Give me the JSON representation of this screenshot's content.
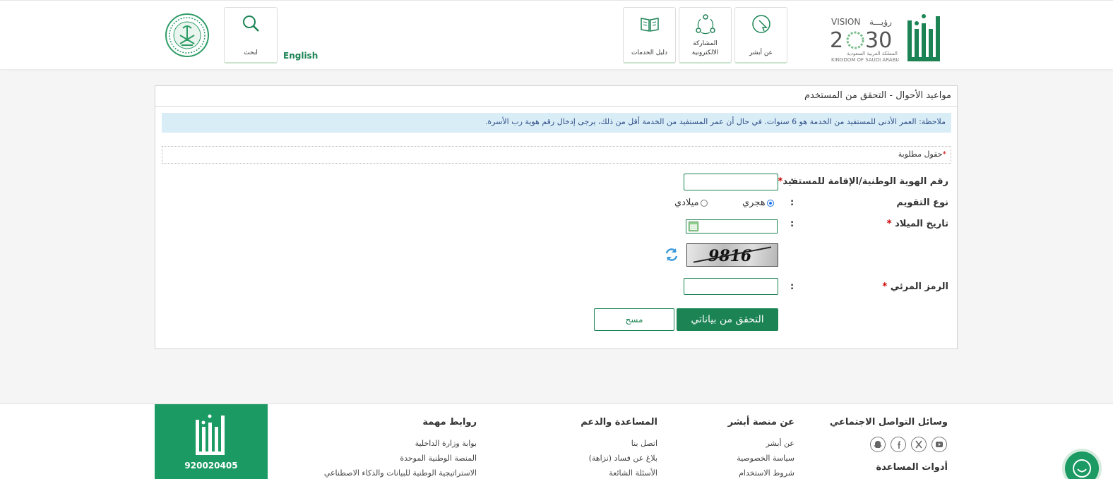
{
  "header": {
    "nav": [
      {
        "label": "عن أبشر"
      },
      {
        "label": "المشاركة الالكترونية"
      },
      {
        "label": "دليل الخدمات"
      }
    ],
    "search_label": "ابحث",
    "english_label": "English"
  },
  "panel": {
    "title": "مواعيد الأحوال - التحقق من المستخدم",
    "note": "ملاحظة: العمر الأدنى للمستفيد من الخدمة هو 6 سنوات. في حال أن عمر المستفيد من الخدمة أقل من ذلك، يرجى إدخال رقم هوية رب الأسرة.",
    "required_note": "حقول مطلوبة",
    "required_star": "*"
  },
  "form": {
    "id_label": "رقم الهوية الوطنية/الإقامة للمستفيد",
    "id_value": "",
    "calendar_label": "نوع التقويم",
    "calendar_options": [
      {
        "label": "هجري",
        "selected": true
      },
      {
        "label": "ميلادي",
        "selected": false
      }
    ],
    "birth_label": "تاريخ الميلاد",
    "captcha_text": "9816",
    "captcha_label": "الرمز المرئي",
    "captcha_value": "",
    "colon": ":",
    "verify_button": "التحقق من بياناتي",
    "clear_button": "مسح"
  },
  "footer": {
    "phone": "920020405",
    "columns": [
      {
        "title": "وسائل التواصل الاجتماعي",
        "links": []
      },
      {
        "title": "عن منصة أبشر",
        "links": [
          "عن أبشر",
          "سياسة الخصوصية",
          "شروط الاستخدام"
        ]
      },
      {
        "title": "المساعدة والدعم",
        "links": [
          "اتصل بنا",
          "بلاغ عن فساد (نزاهة)",
          "الأسئلة الشائعة"
        ]
      },
      {
        "title": "روابط مهمة",
        "links": [
          "بوابة وزارة الداخلية",
          "المنصة الوطنية الموحدة",
          "الاستراتيجية الوطنية للبيانات والذكاء الاصطناعي"
        ]
      }
    ],
    "tools_title": "أدوات المساعدة",
    "social_icons": [
      "youtube-icon",
      "x-icon",
      "facebook-icon",
      "snapchat-icon"
    ]
  },
  "colors": {
    "brand_green": "#1b8354",
    "footer_green": "#1b9a63",
    "note_bg": "#d9edf7"
  }
}
